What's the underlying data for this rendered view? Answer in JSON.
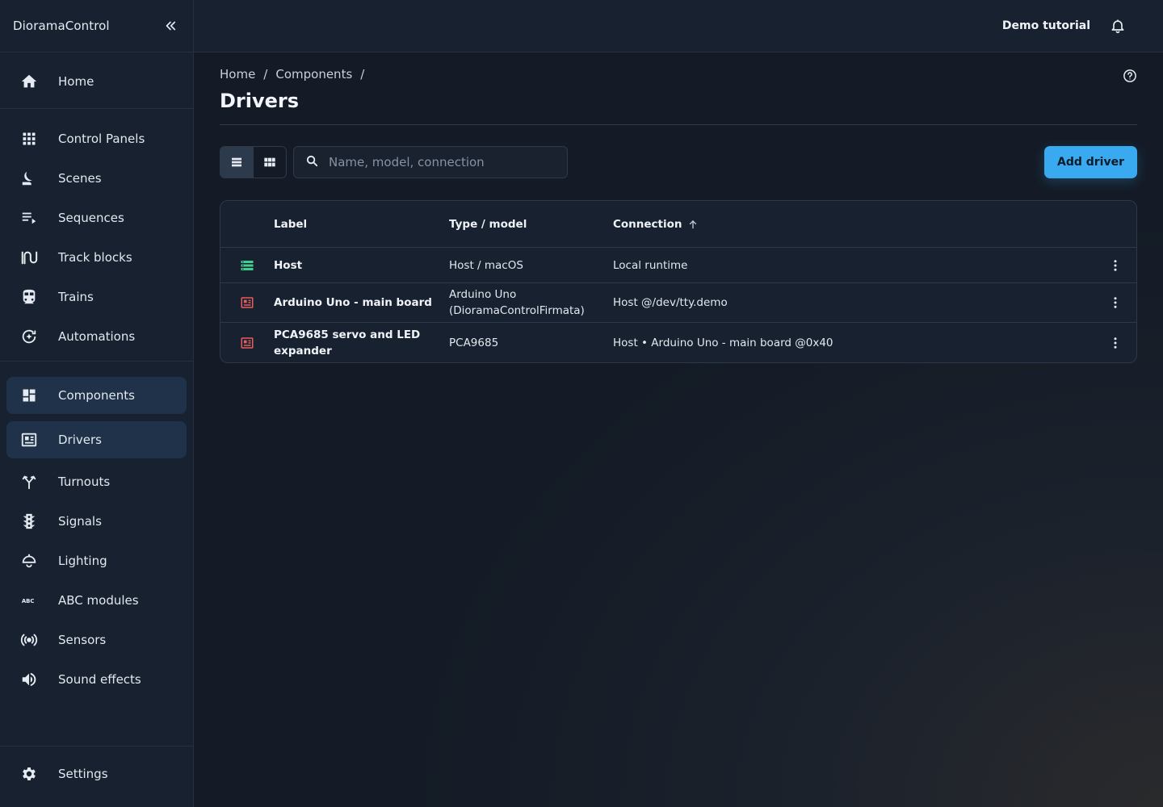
{
  "app": {
    "title": "DioramaControl"
  },
  "topbar": {
    "demo_label": "Demo tutorial"
  },
  "sidebar": {
    "home": "Home",
    "group1": [
      "Control Panels",
      "Scenes",
      "Sequences",
      "Track blocks",
      "Trains",
      "Automations"
    ],
    "components": "Components",
    "group2": [
      "Drivers",
      "Turnouts",
      "Signals",
      "Lighting",
      "ABC modules",
      "Sensors",
      "Sound effects"
    ],
    "settings": "Settings"
  },
  "breadcrumb": {
    "home": "Home",
    "components": "Components",
    "sep": "/"
  },
  "page": {
    "title": "Drivers"
  },
  "search": {
    "placeholder": "Name, model, connection",
    "value": ""
  },
  "add_button": "Add driver",
  "table": {
    "headers": {
      "label": "Label",
      "type": "Type / model",
      "connection": "Connection"
    },
    "sort": {
      "column": "connection",
      "direction": "ascending"
    },
    "rows": [
      {
        "icon": "server-icon",
        "label": "Host",
        "type": "Host / macOS",
        "connection": "Local runtime"
      },
      {
        "icon": "board-icon",
        "label": "Arduino Uno - main board",
        "type": "Arduino Uno (DioramaControlFirmata)",
        "connection": "Host @/dev/tty.demo"
      },
      {
        "icon": "board-icon",
        "label": "PCA9685 servo and LED expander",
        "type": "PCA9685",
        "connection": "Host • Arduino Uno - main board @0x40"
      }
    ]
  },
  "colors": {
    "accent": "#3aaaf0",
    "host_icon": "#3fcf8e",
    "board_icon": "#e85c5c",
    "selected_bg": "#1f3249"
  }
}
